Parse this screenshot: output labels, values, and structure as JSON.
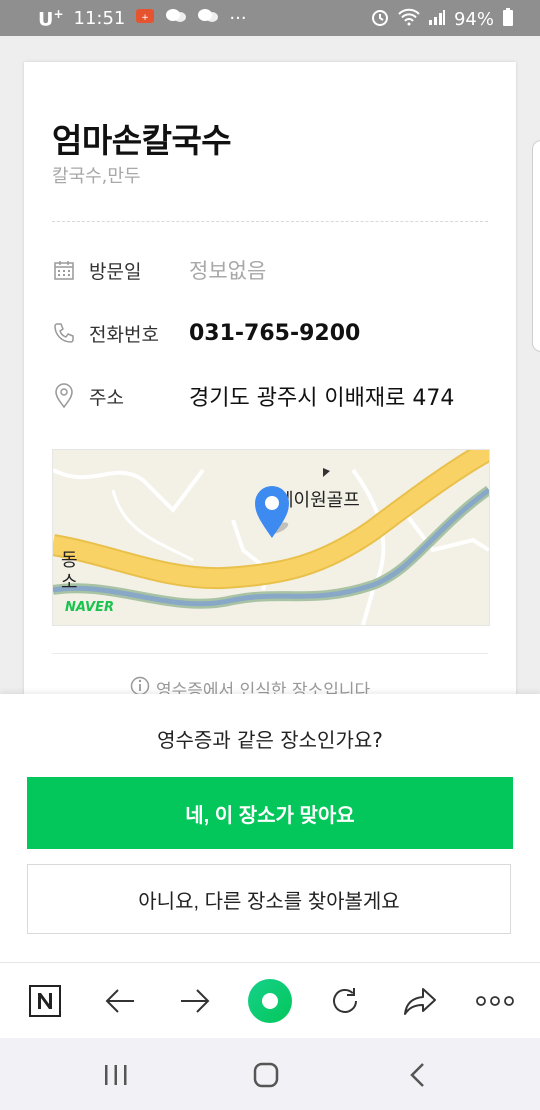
{
  "status_bar": {
    "carrier": "U",
    "carrier_sup": "+",
    "time": "11:51",
    "more": "···",
    "battery": "94%"
  },
  "place": {
    "name": "엄마손칼국수",
    "category": "칼국수,만두",
    "visit_label": "방문일",
    "visit_value": "정보없음",
    "phone_label": "전화번호",
    "phone_value": "031-765-9200",
    "address_label": "주소",
    "address_value": "경기도 광주시 이배재로 474"
  },
  "map": {
    "poi_label": "에이원골프",
    "left_label_1": "동",
    "left_label_2": "소",
    "brand": "NAVER"
  },
  "hint": "영수증에서 인식한 장소입니다",
  "sheet": {
    "question": "영수증과 같은 장소인가요?",
    "yes_label": "네, 이 장소가 맞아요",
    "no_label": "아니요, 다른 장소를 찾아볼게요"
  },
  "colors": {
    "accent_green": "#03c75a",
    "road_yellow": "#f8d264",
    "pin_blue": "#3d8bf0"
  },
  "icons": {
    "toolbar": [
      "naver-n-icon",
      "back-arrow-icon",
      "forward-arrow-icon",
      "green-home-icon",
      "refresh-icon",
      "share-icon",
      "more-icon"
    ],
    "navbar": [
      "recent-apps-icon",
      "home-icon",
      "back-icon"
    ]
  }
}
